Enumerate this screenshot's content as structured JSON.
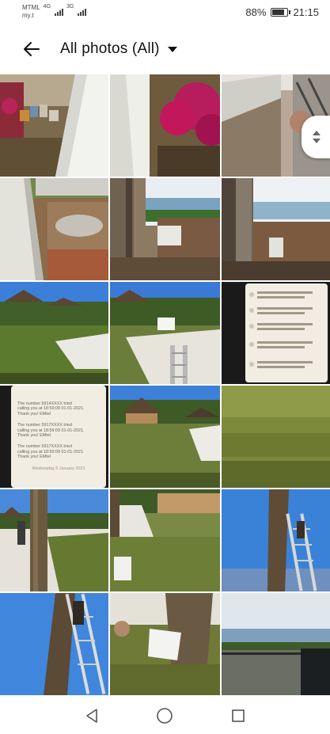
{
  "status_bar": {
    "carrier_line1": "MTML",
    "carrier_line2": "my.t",
    "sim1_tech": "4G",
    "sim2_tech": "3G",
    "battery_percent": "88%",
    "battery_level": 0.88,
    "time": "21:15"
  },
  "toolbar": {
    "title": "All photos (All)"
  },
  "photos": [
    {
      "subject": "garden-pots"
    },
    {
      "subject": "wall-closeup"
    },
    {
      "subject": "bougainvillea"
    },
    {
      "subject": "ladder-over-wall"
    },
    {
      "subject": "wall-rubble"
    },
    {
      "subject": "window-sea-view"
    },
    {
      "subject": "window-sea-view-2"
    },
    {
      "subject": "resort-huts"
    },
    {
      "subject": "beach-ladder"
    },
    {
      "subject": "phone-messages"
    },
    {
      "subject": "phone-messages-2"
    },
    {
      "subject": "huts-path"
    },
    {
      "subject": "lawn"
    },
    {
      "subject": "beach-palm"
    },
    {
      "subject": "garden-palm"
    },
    {
      "subject": "palm-ladder"
    },
    {
      "subject": "trunk-ladder"
    },
    {
      "subject": "trunk-box"
    },
    {
      "subject": "sea-terrace"
    }
  ],
  "phone_messages": [
    {
      "line1": "The number 5914XXXX tried",
      "line2": "calling you at 18:59:09 01-01-2021.",
      "line3": "Thank you! EMtel"
    },
    {
      "line1": "The number 5917XXXX tried",
      "line2": "calling you at 18:59:09 01-01-2021.",
      "line3": "Thank you! EMtel"
    },
    {
      "line1": "The number 5917XXXX tried",
      "line2": "calling you at 18:59:09 01-01-2021.",
      "line3": "Thank you! EMtel"
    }
  ],
  "phone_footer": "Wednesday 6 January 2021",
  "colors": {
    "sky": "#3b7fd9",
    "grass": "#5c7a2e",
    "sand": "#e9e6df",
    "wall": "#d6d6d0",
    "bougainvillea": "#c2185b"
  }
}
